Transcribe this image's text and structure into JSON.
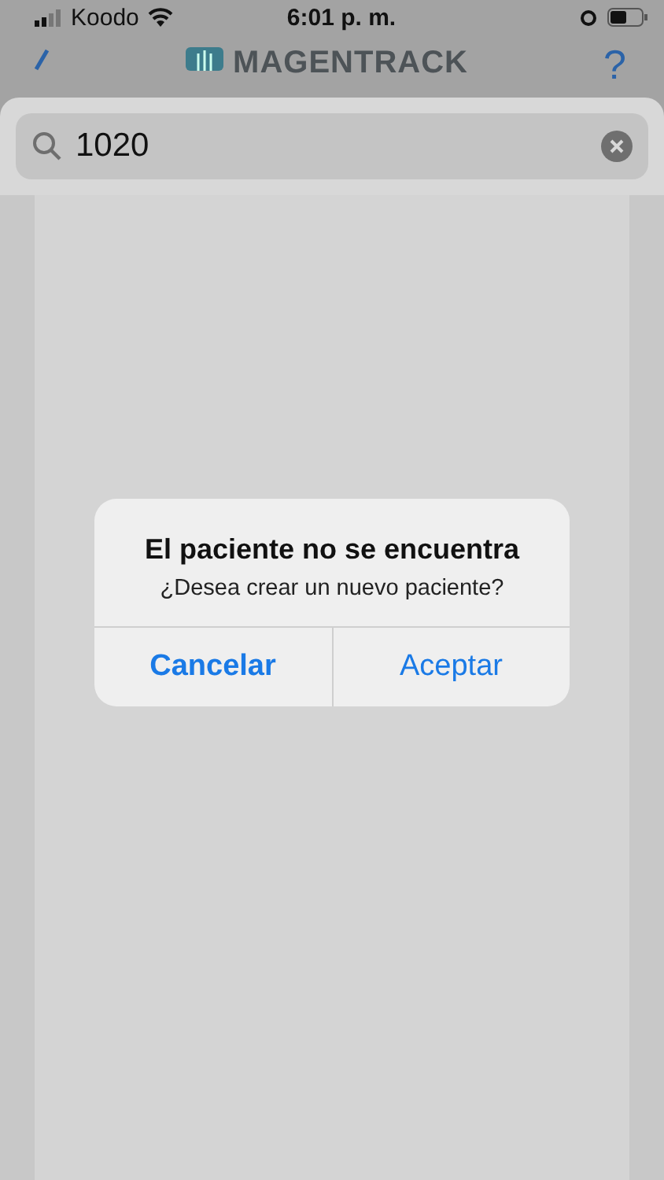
{
  "status_bar": {
    "carrier": "Koodo",
    "time": "6:01 p. m."
  },
  "nav_bar": {
    "title": "MAGENTRACK",
    "help": "?"
  },
  "search": {
    "value": "1020"
  },
  "alert": {
    "title": "El paciente no se encuentra",
    "message": "¿Desea crear un nuevo paciente?",
    "buttons": [
      {
        "label": "Cancelar",
        "kind": "cancel"
      },
      {
        "label": "Aceptar",
        "kind": "default"
      }
    ]
  }
}
